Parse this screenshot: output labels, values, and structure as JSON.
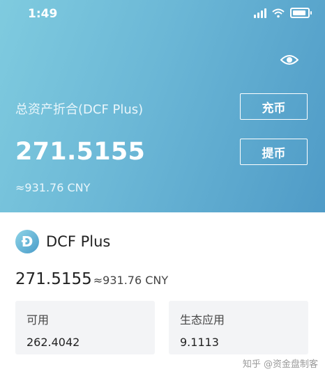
{
  "status_bar": {
    "time": "1:49"
  },
  "header": {
    "total_label": "总资产折合(DCF Plus)",
    "total_amount": "271.5155",
    "total_cny": "≈931.76 CNY",
    "deposit_label": "充币",
    "withdraw_label": "提币"
  },
  "asset": {
    "icon_letter": "Đ",
    "name": "DCF Plus",
    "amount": "271.5155",
    "amount_cny": "≈931.76 CNY",
    "cards": [
      {
        "label": "可用",
        "value": "262.4042"
      },
      {
        "label": "生态应用",
        "value": "9.1113"
      }
    ]
  },
  "watermark": "知乎 @资金盘制客",
  "colors": {
    "accent": "#6bb7d6",
    "card_bg": "#f3f4f6"
  }
}
